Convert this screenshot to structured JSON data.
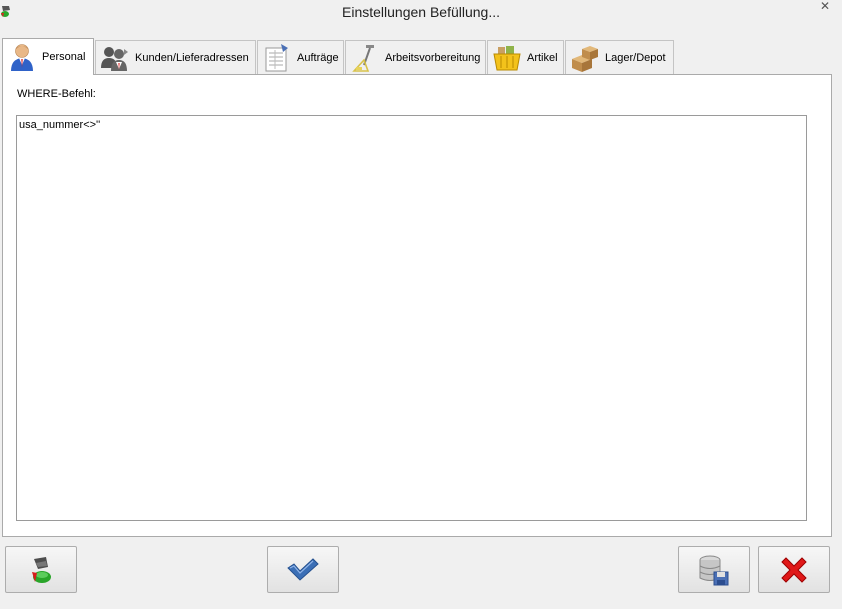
{
  "window": {
    "title": "Einstellungen Befüllung...",
    "close_glyph": "✕"
  },
  "tabs": [
    {
      "label": "Personal",
      "icon": "person-icon",
      "active": true
    },
    {
      "label": "Kunden/Lieferadressen",
      "icon": "customers-icon",
      "active": false
    },
    {
      "label": "Aufträge",
      "icon": "orders-icon",
      "active": false
    },
    {
      "label": "Arbeitsvorbereitung",
      "icon": "work-preparation-icon",
      "active": false
    },
    {
      "label": "Artikel",
      "icon": "basket-icon",
      "active": false
    },
    {
      "label": "Lager/Depot",
      "icon": "boxes-icon",
      "active": false
    }
  ],
  "panel": {
    "where_label": "WHERE-Befehl:",
    "where_value": "usa_nummer<>''"
  },
  "buttons": {
    "fill": {
      "icon": "paint-bucket-icon"
    },
    "confirm": {
      "icon": "checkmark-icon"
    },
    "save": {
      "icon": "database-save-icon"
    },
    "cancel": {
      "icon": "red-x-icon"
    }
  },
  "colors": {
    "window_bg": "#f0f0f0",
    "panel_bg": "#ffffff",
    "check_blue": "#3b6fb6",
    "cancel_red": "#e01818",
    "fill_green": "#2aa52a"
  }
}
